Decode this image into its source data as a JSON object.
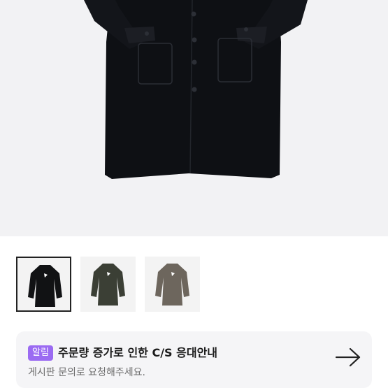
{
  "product": {
    "hero_alt": "black wool coat",
    "thumbnails": [
      {
        "name": "black",
        "color": "#111214",
        "selected": true
      },
      {
        "name": "khaki",
        "color": "#3b3f35",
        "selected": false
      },
      {
        "name": "taupe",
        "color": "#6d665d",
        "selected": false
      }
    ]
  },
  "notice": {
    "badge": "알림",
    "title": "주문량 증가로 인한 C/S 응대안내",
    "subtitle": "게시판 문의로 요청해주세요.",
    "accent": "#9b6bf2"
  }
}
